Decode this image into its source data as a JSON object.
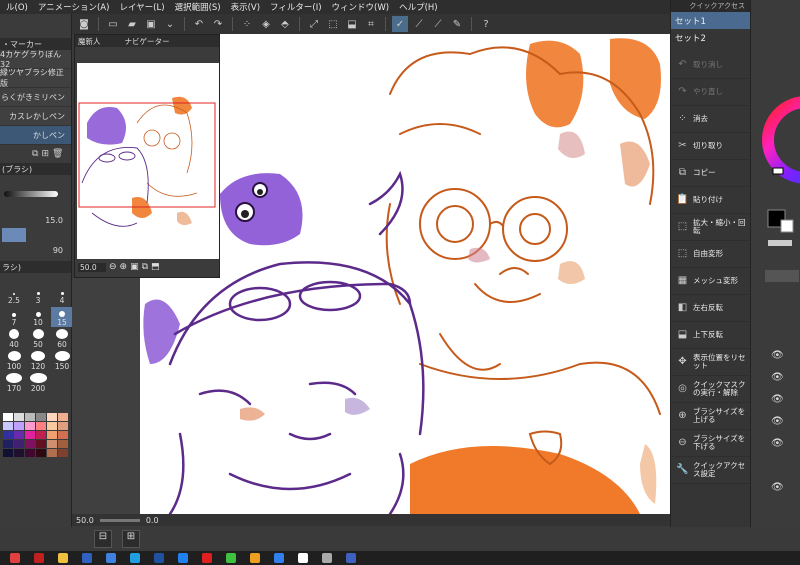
{
  "menubar": {
    "items": [
      "ル(O)",
      "アニメーション(A)",
      "レイヤー(L)",
      "選択範囲(S)",
      "表示(V)",
      "フィルター(I)",
      "ウィンドウ(W)",
      "ヘルプ(H)"
    ]
  },
  "left_panel": {
    "header": "・マーカー",
    "brushes": [
      "4カケグラりぼん32",
      "縁ツヤブラシ修正版",
      "らくがきミリペン",
      "カスレかしペン",
      "かしペン"
    ],
    "brush_size_header": "(ブラシ)",
    "size_value": "15.0",
    "opacity_value": "90",
    "sizes_header": "ラシ)",
    "size_labels": [
      "2.5",
      "3",
      "4",
      "7",
      "10",
      "15",
      "40",
      "50",
      "60",
      "100",
      "120",
      "150",
      "170",
      "200"
    ],
    "selected_size": "15"
  },
  "navigator": {
    "tab1": "魔新人",
    "tab2": "ナビゲーター",
    "zoom": "50.0",
    "rotation": "0.0"
  },
  "statusbar": {
    "zoom": "50.0",
    "rotation": "0.0"
  },
  "quick_access": {
    "title": "クイックアクセス",
    "sets": [
      "セット1",
      "セット2"
    ],
    "selected_set": "セット1",
    "items": [
      {
        "label": "取り消し",
        "icon": "undo-icon",
        "glyph": "↶",
        "enabled": false
      },
      {
        "label": "やり直し",
        "icon": "redo-icon",
        "glyph": "↷",
        "enabled": false
      },
      {
        "label": "消去",
        "icon": "clear-icon",
        "glyph": "⁘",
        "enabled": true
      },
      {
        "label": "切り取り",
        "icon": "cut-icon",
        "glyph": "✂",
        "enabled": true
      },
      {
        "label": "コピー",
        "icon": "copy-icon",
        "glyph": "⧉",
        "enabled": true
      },
      {
        "label": "貼り付け",
        "icon": "paste-icon",
        "glyph": "📋",
        "enabled": true
      },
      {
        "label": "拡大・縮小・回転",
        "icon": "scale-rotate-icon",
        "glyph": "⬚",
        "enabled": true
      },
      {
        "label": "自由変形",
        "icon": "free-transform-icon",
        "glyph": "⬚",
        "enabled": true
      },
      {
        "label": "メッシュ変形",
        "icon": "mesh-transform-icon",
        "glyph": "▦",
        "enabled": true
      },
      {
        "label": "左右反転",
        "icon": "flip-horizontal-icon",
        "glyph": "◧",
        "enabled": true
      },
      {
        "label": "上下反転",
        "icon": "flip-vertical-icon",
        "glyph": "⬓",
        "enabled": true
      },
      {
        "label": "表示位置をリセット",
        "icon": "reset-view-icon",
        "glyph": "✥",
        "enabled": true
      },
      {
        "label": "クイックマスクの実行・解除",
        "icon": "quick-mask-icon",
        "glyph": "◎",
        "enabled": true
      },
      {
        "label": "ブラシサイズを上げる",
        "icon": "brush-size-up-icon",
        "glyph": "⊕",
        "enabled": true
      },
      {
        "label": "ブラシサイズを下げる",
        "icon": "brush-size-down-icon",
        "glyph": "⊖",
        "enabled": true
      },
      {
        "label": "クイックアクセス設定",
        "icon": "settings-wrench-icon",
        "glyph": "🔧",
        "enabled": true
      }
    ]
  },
  "colors": {
    "accent": "#4a6b8f",
    "purple_line": "#5b2a8a",
    "orange_line": "#c65a1a",
    "orange_paint": "#f07a2a",
    "purple_paint": "#8e5ad6"
  }
}
